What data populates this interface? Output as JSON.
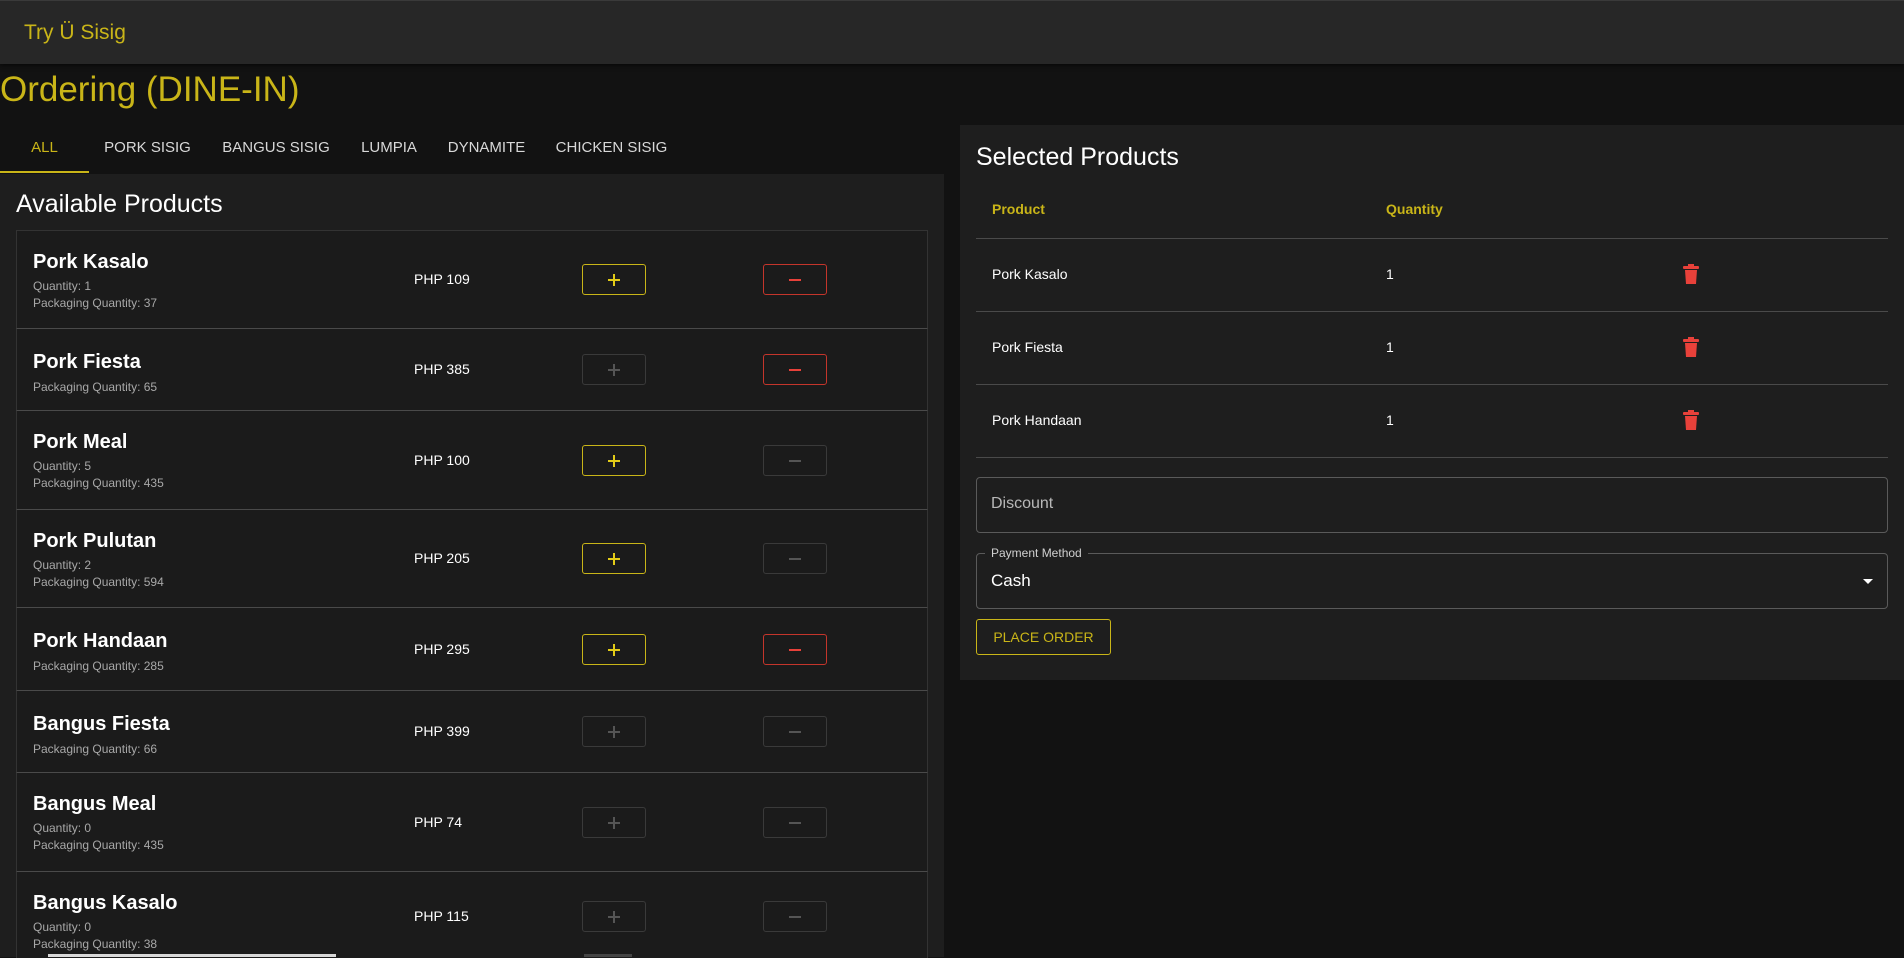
{
  "app": {
    "title": "Try Ü Sisig"
  },
  "page": {
    "title": "Ordering (DINE-IN)"
  },
  "tabs": [
    {
      "label": "ALL",
      "active": true
    },
    {
      "label": "PORK SISIG",
      "active": false
    },
    {
      "label": "BANGUS SISIG",
      "active": false
    },
    {
      "label": "LUMPIA",
      "active": false
    },
    {
      "label": "DYNAMITE",
      "active": false
    },
    {
      "label": "CHICKEN SISIG",
      "active": false
    }
  ],
  "available": {
    "title": "Available Products",
    "products": [
      {
        "name": "Pork Kasalo",
        "quantity": "Quantity: 1",
        "packaging": "Packaging Quantity: 37",
        "price": "PHP 109",
        "plus_enabled": true,
        "minus_enabled": true
      },
      {
        "name": "Pork Fiesta",
        "quantity": "",
        "packaging": "Packaging Quantity: 65",
        "price": "PHP 385",
        "plus_enabled": false,
        "minus_enabled": true
      },
      {
        "name": "Pork Meal",
        "quantity": "Quantity: 5",
        "packaging": "Packaging Quantity: 435",
        "price": "PHP 100",
        "plus_enabled": true,
        "minus_enabled": false
      },
      {
        "name": "Pork Pulutan",
        "quantity": "Quantity: 2",
        "packaging": "Packaging Quantity: 594",
        "price": "PHP 205",
        "plus_enabled": true,
        "minus_enabled": false
      },
      {
        "name": "Pork Handaan",
        "quantity": "",
        "packaging": "Packaging Quantity: 285",
        "price": "PHP 295",
        "plus_enabled": true,
        "minus_enabled": true
      },
      {
        "name": "Bangus Fiesta",
        "quantity": "",
        "packaging": "Packaging Quantity: 66",
        "price": "PHP 399",
        "plus_enabled": false,
        "minus_enabled": false
      },
      {
        "name": "Bangus Meal",
        "quantity": "Quantity: 0",
        "packaging": "Packaging Quantity: 435",
        "price": "PHP 74",
        "plus_enabled": false,
        "minus_enabled": false
      },
      {
        "name": "Bangus Kasalo",
        "quantity": "Quantity: 0",
        "packaging": "Packaging Quantity: 38",
        "price": "PHP 115",
        "plus_enabled": false,
        "minus_enabled": false
      }
    ]
  },
  "selected": {
    "title": "Selected Products",
    "columns": {
      "product": "Product",
      "quantity": "Quantity"
    },
    "rows": [
      {
        "product": "Pork Kasalo",
        "quantity": "1"
      },
      {
        "product": "Pork Fiesta",
        "quantity": "1"
      },
      {
        "product": "Pork Handaan",
        "quantity": "1"
      }
    ],
    "discount_placeholder": "Discount",
    "payment_label": "Payment Method",
    "payment_value": "Cash",
    "place_order_label": "PLACE ORDER"
  },
  "colors": {
    "accent": "#c9b518",
    "danger": "#e8413a",
    "background": "#121212",
    "panel": "#1e1e1e"
  }
}
